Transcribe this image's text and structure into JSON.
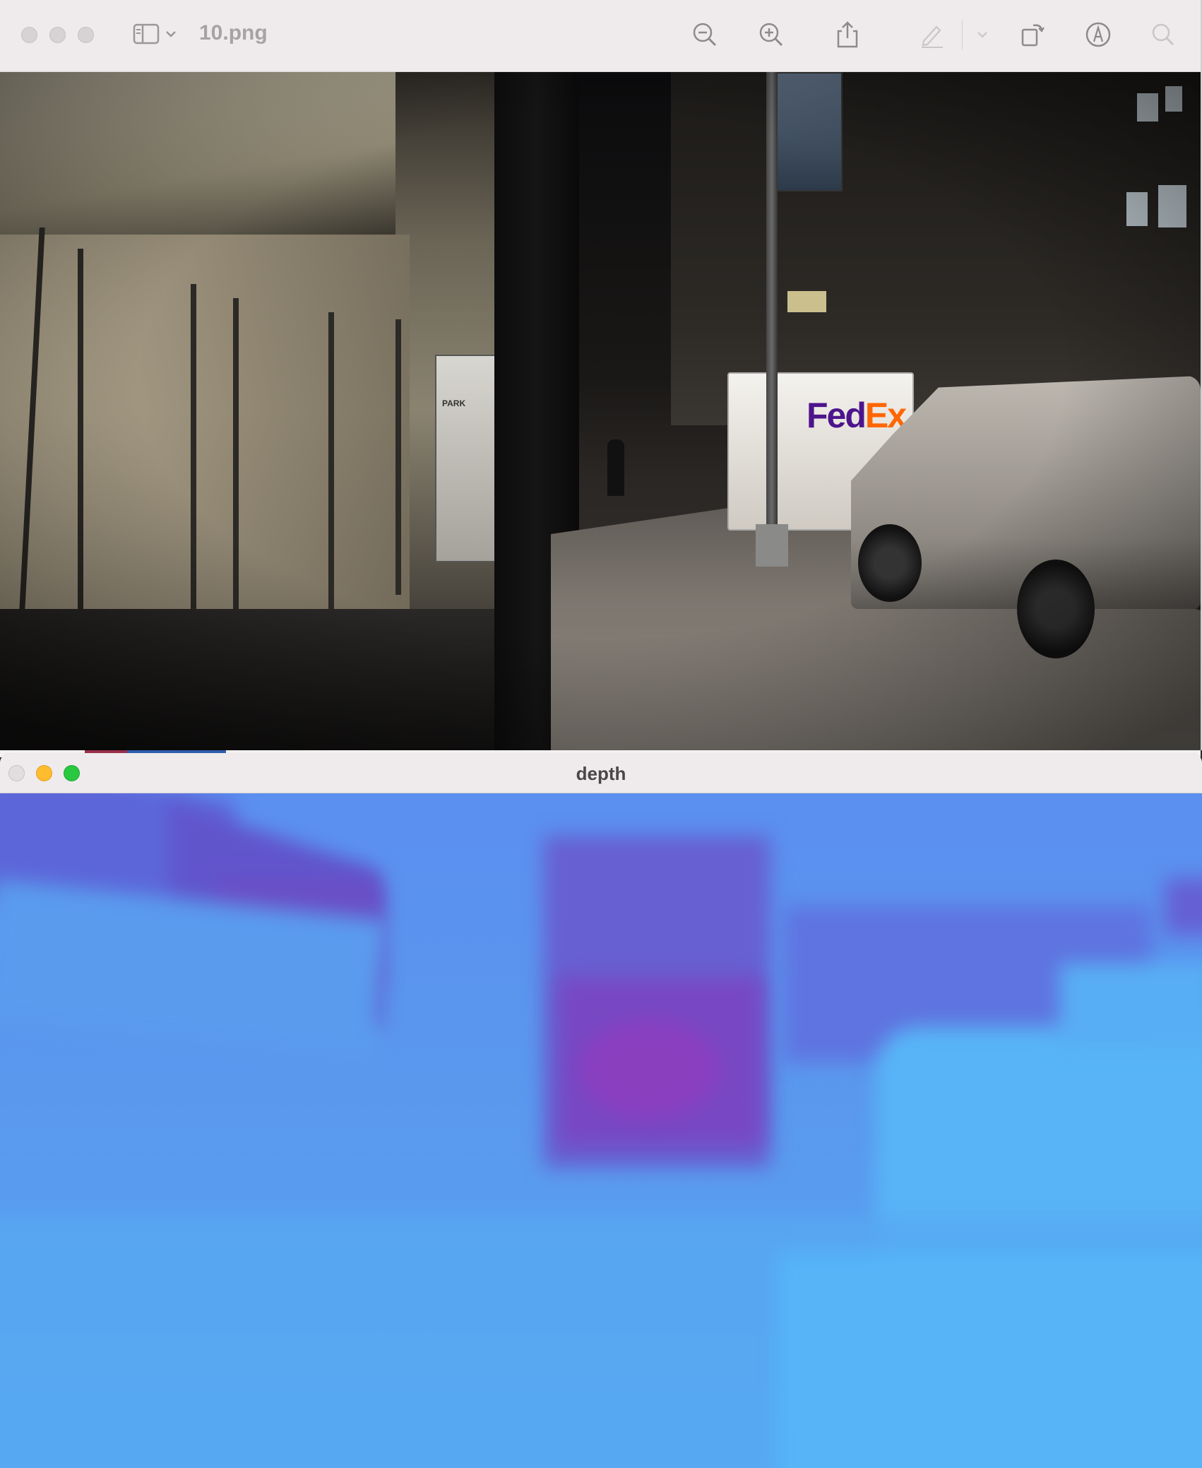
{
  "preview_window": {
    "title": "10.png",
    "toolbar_icons": [
      "sidebar-icon",
      "chevron-down-icon",
      "zoom-out-icon",
      "zoom-in-icon",
      "share-icon",
      "highlight-pen-icon",
      "chevron-down-icon",
      "rotate-icon",
      "markup-icon",
      "search-icon"
    ],
    "photo": {
      "sign_text": "PARK",
      "truck_brand_fed": "Fed",
      "truck_brand_ex": "Ex"
    }
  },
  "depth_window": {
    "title": "depth",
    "colors": {
      "near": "#5ab8f8",
      "mid": "#5a8de8",
      "far": "#8a3fbf"
    }
  },
  "colors": {
    "titlebar_bg": "#efebec",
    "close": "#e2dedf",
    "minimize": "#febc2e",
    "zoom": "#28c840",
    "fedex_purple": "#4d148c",
    "fedex_orange": "#ff6600"
  }
}
